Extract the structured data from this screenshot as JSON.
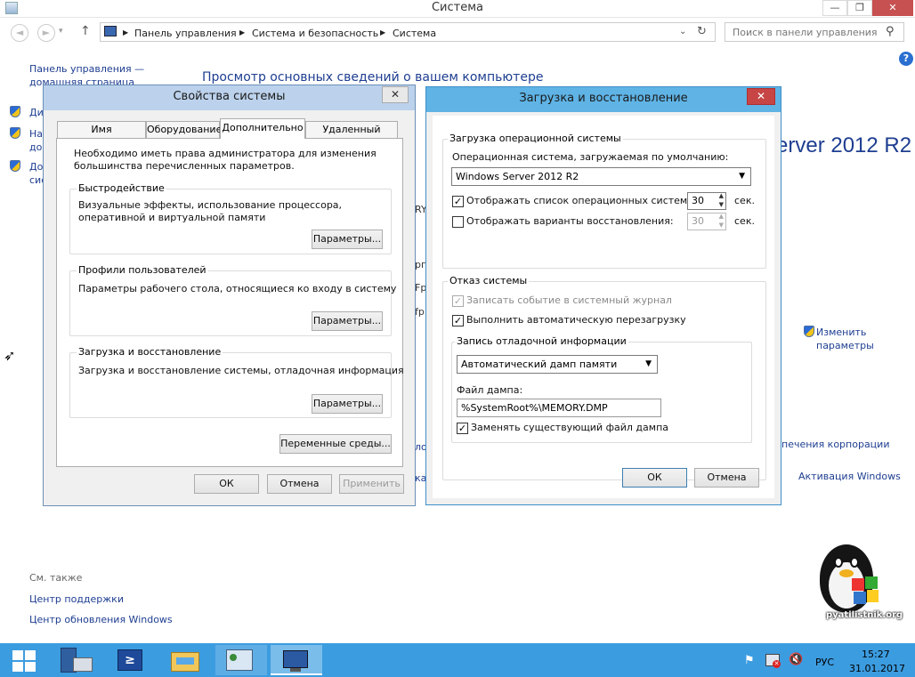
{
  "window": {
    "title": "Система",
    "min": "—",
    "max": "❐",
    "close": "✕"
  },
  "nav": {
    "back": "◄",
    "forward": "►",
    "up": "↑",
    "crumbs": [
      "Панель управления",
      "Система и безопасность",
      "Система"
    ],
    "search_placeholder": "Поиск в панели управления"
  },
  "sidebar": {
    "home": "Панель управления — домашняя страница",
    "items": [
      "Ди",
      "На\nдо",
      "До\nсис"
    ]
  },
  "main": {
    "heading": "Просмотр основных сведений о вашем компьютере",
    "edition": "erver 2012 R2",
    "change_settings": "Изменить параметры",
    "license": "печения корпорации",
    "activation": "Активация Windows",
    "partial": [
      "RY",
      "рг",
      "Fp",
      "fp"
    ],
    "partial_bottom": [
      "ло",
      "ка"
    ]
  },
  "see_also": {
    "title": "См. также",
    "links": [
      "Центр поддержки",
      "Центр обновления Windows"
    ]
  },
  "sysprops": {
    "title": "Свойства системы",
    "close": "✕",
    "tabs": [
      "Имя компьютера",
      "Оборудование",
      "Дополнительно",
      "Удаленный доступ"
    ],
    "admin_note": "Необходимо иметь права администратора для изменения большинства перечисленных параметров.",
    "groups": [
      {
        "title": "Быстродействие",
        "desc": "Визуальные эффекты, использование процессора, оперативной и виртуальной памяти",
        "button": "Параметры..."
      },
      {
        "title": "Профили пользователей",
        "desc": "Параметры рабочего стола, относящиеся ко входу в систему",
        "button": "Параметры..."
      },
      {
        "title": "Загрузка и восстановление",
        "desc": "Загрузка и восстановление системы, отладочная информация",
        "button": "Параметры..."
      }
    ],
    "env_button": "Переменные среды...",
    "ok": "ОК",
    "cancel": "Отмена",
    "apply": "Применить"
  },
  "startup": {
    "title": "Загрузка и восстановление",
    "close": "✕",
    "os_group": "Загрузка операционной системы",
    "default_os_label": "Операционная система, загружаемая по умолчанию:",
    "default_os_value": "Windows Server 2012 R2",
    "show_list_label": "Отображать список операционных систем:",
    "show_list_checked": true,
    "show_list_value": "30",
    "show_recovery_label": "Отображать варианты восстановления:",
    "show_recovery_checked": false,
    "show_recovery_value": "30",
    "sec": "сек.",
    "failure_group": "Отказ системы",
    "write_event_label": "Записать событие в системный журнал",
    "auto_restart_label": "Выполнить автоматическую перезагрузку",
    "debug_group": "Запись отладочной информации",
    "dump_type": "Автоматический дамп памяти",
    "dump_file_label": "Файл дампа:",
    "dump_file_value": "%SystemRoot%\\MEMORY.DMP",
    "overwrite_label": "Заменять существующий файл дампа",
    "ok": "ОК",
    "cancel": "Отмена"
  },
  "watermark": "pyatilistnik.org",
  "taskbar": {
    "lang": "РУС",
    "time": "15:27",
    "date": "31.01.2017"
  },
  "colors": {
    "taskbar": "#3c9ce0",
    "link": "#1e3e91",
    "dialog_title": "#5fb3e5"
  }
}
